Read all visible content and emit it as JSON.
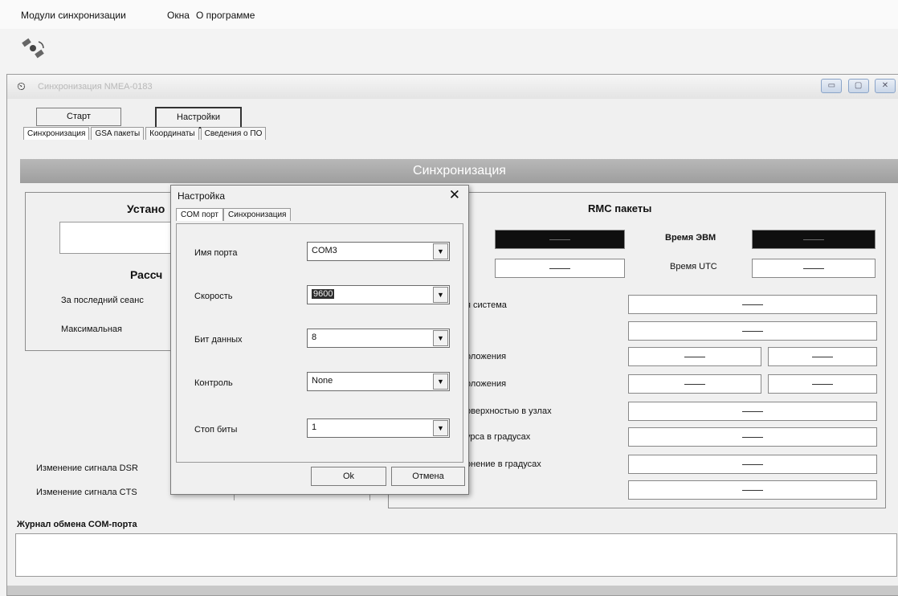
{
  "menu": [
    "Модули синхронизации",
    "Окна",
    "О программе"
  ],
  "window": {
    "title": "Синхронизация NMEA-0183",
    "controls": [
      "▭",
      "▢",
      "✕"
    ]
  },
  "toolbar": {
    "start": "Старт",
    "settings": "Настройки"
  },
  "tabs": [
    "Синхронизация",
    "GSA пакеты",
    "Координаты",
    "Сведения о ПО"
  ],
  "header": "Синхронизация",
  "left_panel": {
    "title_partial": "Устано",
    "subtitle_partial": "Рассч",
    "last_session": "За последний сеанс",
    "max": "Максимальная",
    "dsr": "Изменение сигнала DSR",
    "cts": "Изменение сигнала CTS"
  },
  "rmc": {
    "title": "RMC пакеты",
    "pc_time": "Время ЭВМ",
    "utc_time": "Время UTC",
    "dash": "——",
    "labels": [
      "я система",
      "оложения",
      "оложения",
      "оверхностью в узлах",
      "урса в градусах",
      "онение в градусах"
    ]
  },
  "log_title": "Журнал обмена COM-порта",
  "dialog": {
    "title": "Настройка",
    "close": "✕",
    "tabs": [
      "COM порт",
      "Синхронизация"
    ],
    "fields": [
      {
        "label": "Имя порта",
        "value": "COM3"
      },
      {
        "label": "Скорость",
        "value": "9600"
      },
      {
        "label": "Бит данных",
        "value": "8"
      },
      {
        "label": "Контроль",
        "value": "None"
      },
      {
        "label": "Стоп биты",
        "value": "1"
      }
    ],
    "ok": "Ok",
    "cancel": "Отмена"
  }
}
